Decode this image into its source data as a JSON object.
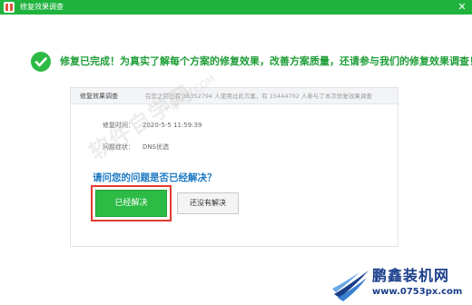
{
  "window": {
    "title": "修复效果调查",
    "close_glyph": "✕"
  },
  "headline": "修复已完成！为真实了解每个方案的修复效果，改善方案质量，还请参与我们的修复效果调查！",
  "panel": {
    "title": "修复效果调查",
    "stats": "在您之前已有 35352794 人使用过此方案，有 15444702 人参与了本次修复效果调查",
    "time_label": "修复时间：",
    "time_value": "2020-5-5 11:59:39",
    "issue_label": "问题症状：",
    "issue_value": "DNS优选",
    "question": "请问您的问题是否已经解决？",
    "solved_button": "已经解决",
    "unsolved_button": "还没有解决"
  },
  "watermark": {
    "big": "软件自学网",
    "small": "RJZXW.COM"
  },
  "brand": {
    "name": "鹏鑫装机网",
    "url": "www.0753px.com"
  },
  "colors": {
    "titlebar": "#1fb33d",
    "headline": "#1e9e37",
    "question": "#1a78c2",
    "primary_button": "#2dba45",
    "highlight": "#e23b2e",
    "brand": "#1a3e8a"
  }
}
